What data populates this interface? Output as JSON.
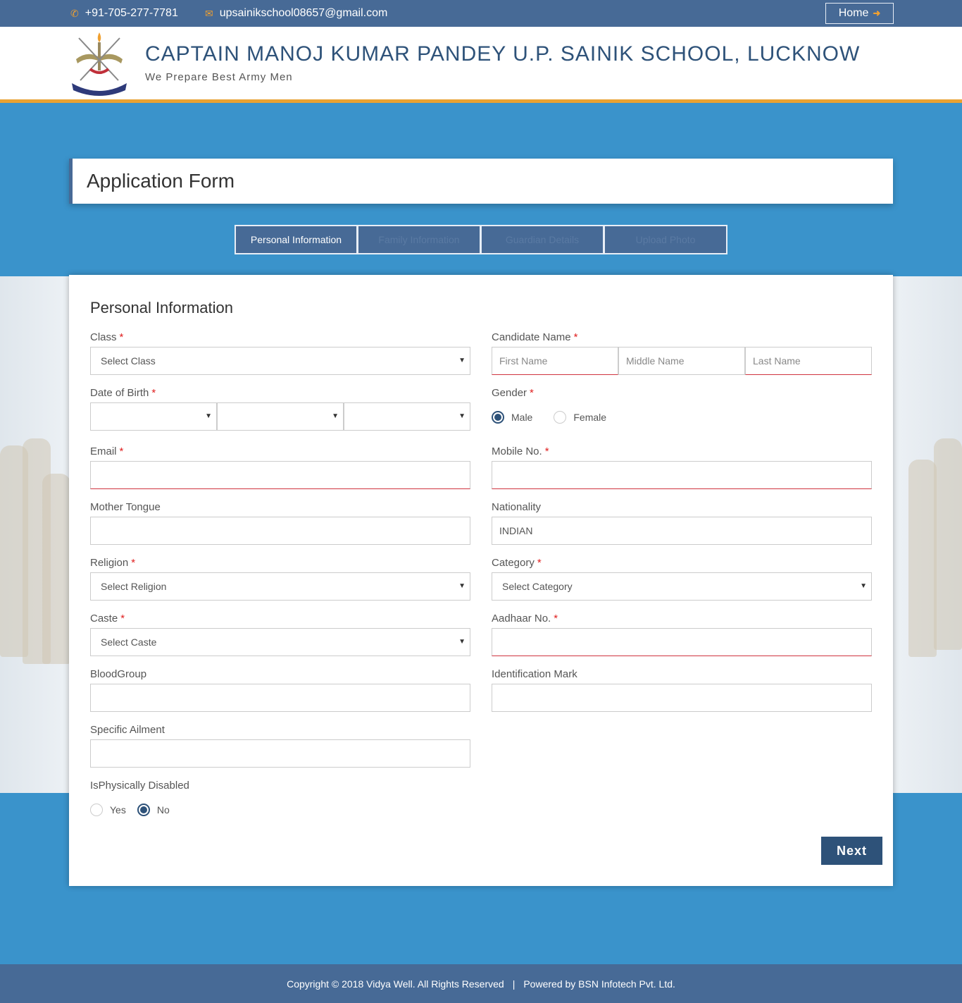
{
  "topbar": {
    "phone": "+91-705-277-7781",
    "email": "upsainikschool08657@gmail.com",
    "home_label": "Home",
    "phone_icon": "phone-icon",
    "email_icon": "envelope-icon"
  },
  "header": {
    "school_name": "CAPTAIN MANOJ KUMAR PANDEY U.P. SAINIK SCHOOL, LUCKNOW",
    "tagline": "We Prepare Best Army Men"
  },
  "page_title": "Application Form",
  "steps": [
    {
      "label": "Personal Information",
      "active": true
    },
    {
      "label": "Family Information",
      "active": false
    },
    {
      "label": "Guardian Details",
      "active": false
    },
    {
      "label": "Upload Photo",
      "active": false
    }
  ],
  "form": {
    "section_title": "Personal Information",
    "class_label": "Class",
    "class_value": "Select Class",
    "candidate_name_label": "Candidate Name",
    "first_name_placeholder": "First Name",
    "middle_name_placeholder": "Middle Name",
    "last_name_placeholder": "Last Name",
    "dob_label": "Date of Birth",
    "gender_label": "Gender",
    "gender_options": [
      "Male",
      "Female"
    ],
    "gender_selected": "Male",
    "email_label": "Email",
    "mobile_label": "Mobile No.",
    "mother_tongue_label": "Mother Tongue",
    "nationality_label": "Nationality",
    "nationality_value": "INDIAN",
    "religion_label": "Religion",
    "religion_value": "Select Religion",
    "category_label": "Category",
    "category_value": "Select Category",
    "caste_label": "Caste",
    "caste_value": "Select Caste",
    "aadhaar_label": "Aadhaar No.",
    "blood_group_label": "BloodGroup",
    "identification_mark_label": "Identification Mark",
    "specific_ailment_label": "Specific Ailment",
    "disabled_label": "IsPhysically Disabled",
    "disabled_options": [
      "Yes",
      "No"
    ],
    "disabled_selected": "No",
    "required_marker": "*",
    "next_label": "Next"
  },
  "footer": {
    "copyright": "Copyright © 2018 Vidya Well. All Rights Reserved",
    "separator": "|",
    "powered_by": "Powered by BSN Infotech Pvt. Ltd."
  },
  "colors": {
    "topbar": "#476a96",
    "accent_orange": "#e9a231",
    "band_blue": "#3a93cb",
    "title_blue": "#2e5279",
    "required_red": "#e02020"
  }
}
